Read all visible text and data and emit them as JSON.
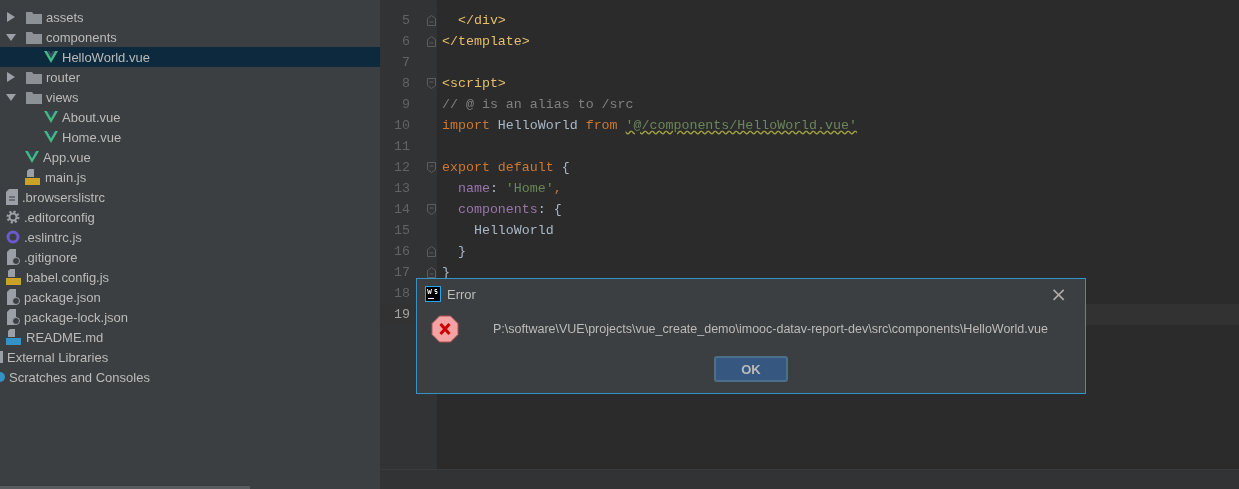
{
  "project_tree": {
    "src_items": [
      {
        "label": "assets",
        "kind": "folder",
        "expanded": false,
        "selected": false
      },
      {
        "label": "components",
        "kind": "folder",
        "expanded": true,
        "selected": false,
        "children": [
          {
            "label": "HelloWorld.vue",
            "kind": "vue",
            "selected": true
          }
        ]
      },
      {
        "label": "router",
        "kind": "folder",
        "expanded": false,
        "selected": false
      },
      {
        "label": "views",
        "kind": "folder",
        "expanded": true,
        "selected": false,
        "children": [
          {
            "label": "About.vue",
            "kind": "vue",
            "selected": false
          },
          {
            "label": "Home.vue",
            "kind": "vue",
            "selected": false
          }
        ]
      },
      {
        "label": "App.vue",
        "kind": "vue",
        "selected": false
      },
      {
        "label": "main.js",
        "kind": "js",
        "selected": false
      }
    ],
    "root_items": [
      {
        "label": ".browserslistrc",
        "kind": "text",
        "selected": false
      },
      {
        "label": ".editorconfig",
        "kind": "config",
        "selected": false
      },
      {
        "label": ".eslintrc.js",
        "kind": "eslint",
        "selected": false
      },
      {
        "label": ".gitignore",
        "kind": "ignore",
        "selected": false
      },
      {
        "label": "babel.config.js",
        "kind": "js",
        "selected": false
      },
      {
        "label": "package.json",
        "kind": "json",
        "selected": false
      },
      {
        "label": "package-lock.json",
        "kind": "json",
        "selected": false
      },
      {
        "label": "README.md",
        "kind": "markdown",
        "selected": false
      }
    ],
    "extra_items": [
      {
        "label": "External Libraries",
        "kind": "library",
        "selected": false
      },
      {
        "label": "Scratches and Consoles",
        "kind": "scratch",
        "selected": false
      }
    ]
  },
  "editor": {
    "lines": [
      {
        "number": "5",
        "fold_start": false,
        "fold_end": true,
        "current": false,
        "tokens": [
          {
            "text": "  </div>",
            "kind": "tag"
          }
        ]
      },
      {
        "number": "6",
        "fold_start": false,
        "fold_end": true,
        "current": false,
        "tokens": [
          {
            "text": "</template>",
            "kind": "tag"
          }
        ]
      },
      {
        "number": "7",
        "fold_start": false,
        "fold_end": false,
        "current": false
      },
      {
        "number": "8",
        "fold_start": true,
        "fold_end": false,
        "current": false,
        "tokens": [
          {
            "text": "<script>",
            "kind": "tag"
          }
        ]
      },
      {
        "number": "9",
        "fold_start": false,
        "fold_end": false,
        "current": false,
        "tokens": [
          {
            "text": "// @ is an alias to /src",
            "kind": "comment"
          }
        ]
      },
      {
        "number": "10",
        "fold_start": false,
        "fold_end": false,
        "current": false,
        "tokens": [
          {
            "text": "import",
            "kind": "keyword"
          },
          {
            "text": " HelloWorld ",
            "kind": "ident"
          },
          {
            "text": "from ",
            "kind": "keyword"
          },
          {
            "text": "'@/components/HelloWorld.vue'",
            "kind": "string",
            "warning": true
          }
        ]
      },
      {
        "number": "11",
        "fold_start": false,
        "fold_end": false,
        "current": false
      },
      {
        "number": "12",
        "fold_start": true,
        "fold_end": false,
        "current": false,
        "tokens": [
          {
            "text": "export default",
            "kind": "keyword"
          },
          {
            "text": " {",
            "kind": "punct"
          }
        ]
      },
      {
        "number": "13",
        "fold_start": false,
        "fold_end": false,
        "current": false,
        "tokens": [
          {
            "text": "  name",
            "kind": "prop"
          },
          {
            "text": ": ",
            "kind": "punct"
          },
          {
            "text": "'Home'",
            "kind": "string"
          },
          {
            "text": ",",
            "kind": "keyword"
          }
        ]
      },
      {
        "number": "14",
        "fold_start": true,
        "fold_end": false,
        "current": false,
        "tokens": [
          {
            "text": "  components",
            "kind": "prop"
          },
          {
            "text": ": {",
            "kind": "punct"
          }
        ]
      },
      {
        "number": "15",
        "fold_start": false,
        "fold_end": false,
        "current": false,
        "tokens": [
          {
            "text": "    HelloWorld",
            "kind": "ident"
          }
        ]
      },
      {
        "number": "16",
        "fold_start": false,
        "fold_end": true,
        "current": false,
        "tokens": [
          {
            "text": "  }",
            "kind": "punct"
          }
        ]
      },
      {
        "number": "17",
        "fold_start": false,
        "fold_end": true,
        "current": false,
        "tokens": [
          {
            "text": "}",
            "kind": "punct"
          }
        ]
      },
      {
        "number": "18",
        "fold_start": false,
        "fold_end": false,
        "current": false
      },
      {
        "number": "19",
        "fold_start": false,
        "fold_end": false,
        "current": true
      }
    ]
  },
  "dialog": {
    "title": "Error",
    "close": "×",
    "message": "P:\\software\\VUE\\projects\\vue_create_demo\\imooc-datav-report-dev\\src\\components\\HelloWorld.vue",
    "buttons": [
      "OK"
    ]
  }
}
